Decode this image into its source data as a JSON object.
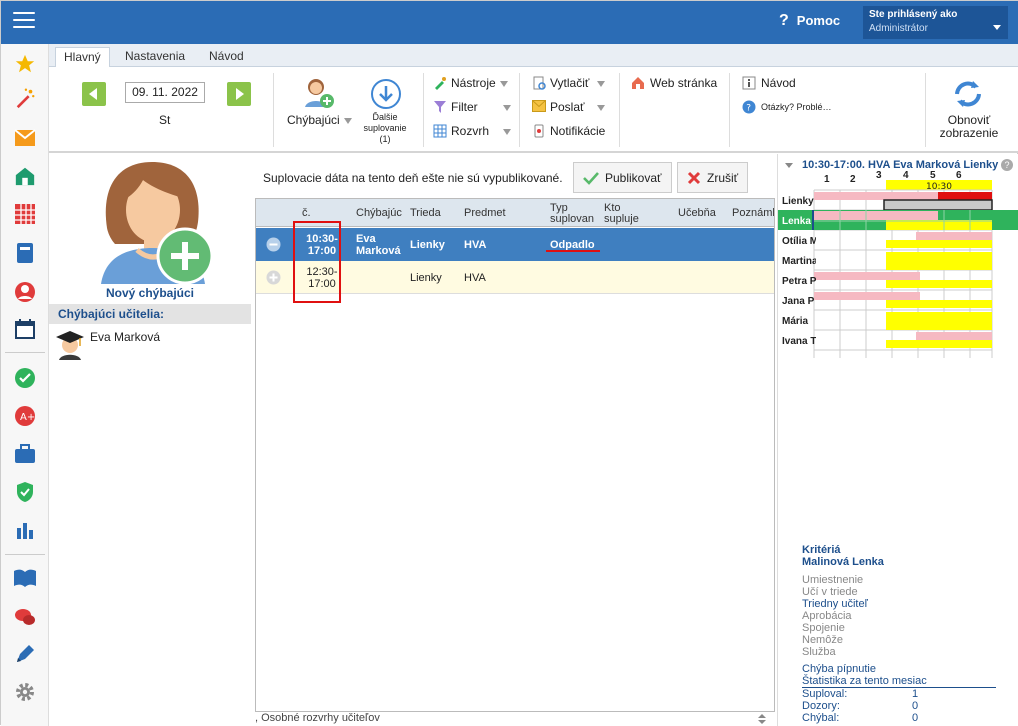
{
  "header": {
    "help": "Pomoc",
    "user_line1": "Ste prihlásený ako",
    "user_line2": "Administrátor"
  },
  "tabs": [
    {
      "label": "Hlavný"
    },
    {
      "label": "Nastavenia"
    },
    {
      "label": "Návod"
    }
  ],
  "ribbon": {
    "date": "09. 11. 2022",
    "day": "St",
    "chybajuci": "Chýbajúci",
    "dalsie_1": "Ďalšie",
    "dalsie_2": "suplovanie",
    "dalsie_3": "(1)",
    "nastroje": "Nástroje",
    "filter": "Filter",
    "rozvrh": "Rozvrh",
    "vytlacit": "Vytlačiť",
    "poslat": "Poslať",
    "notifikacie": "Notifikácie",
    "web": "Web stránka",
    "navod": "Návod",
    "otazky": "Otázky? Problé…",
    "obnovit_1": "Obnoviť",
    "obnovit_2": "zobrazenie"
  },
  "left": {
    "new_absent": "Nový chýbajúci",
    "section": "Chýbajúci učitelia:",
    "teacher": "Eva Marková"
  },
  "center": {
    "message": "Suplovacie dáta na tento deň ešte nie sú vypublikované.",
    "publish": "Publikovať",
    "cancel": "Zrušiť",
    "columns": {
      "c": "č.",
      "chybajuci": "Chýbajúc",
      "trieda": "Trieda",
      "predmet": "Predmet",
      "typ_1": "Typ",
      "typ_2": "suplovan",
      "kto_1": "Kto",
      "kto_2": "supluje",
      "ucebna": "Učebňa",
      "poznamka": "Poznámk"
    },
    "rows": [
      {
        "time_1": "10:30-",
        "time_2": "17:00",
        "absent_1": "Eva",
        "absent_2": "Marková",
        "trieda": "Lienky",
        "predmet": "HVA",
        "typ": "Odpadlo"
      },
      {
        "time_1": "12:30-",
        "time_2": "17:00",
        "absent_1": "",
        "absent_2": "",
        "trieda": "Lienky",
        "predmet": "HVA",
        "typ": ""
      }
    ],
    "status": ", Osobné rozvrhy učiteľov"
  },
  "right": {
    "title": "10:30-17:00. HVA Eva Marková Lienky",
    "slots": [
      "1",
      "2",
      "3",
      "4",
      "5",
      "6"
    ],
    "slot_time": "10:30",
    "teachers": [
      "Lienky",
      "Lenka",
      "Otília M",
      "Martina",
      "Petra P",
      "Jana P",
      "Mária",
      "Ivana T"
    ],
    "criteria_title": "Kritériá",
    "criteria_name": "Malinová Lenka",
    "criteria": [
      {
        "label": "Umiestnenie",
        "active": false
      },
      {
        "label": "Učí v triede",
        "active": false
      },
      {
        "label": "Triedny učiteľ",
        "active": true
      },
      {
        "label": "Aprobácia",
        "active": false
      },
      {
        "label": "Spojenie",
        "active": false
      },
      {
        "label": "Nemôže",
        "active": false
      },
      {
        "label": "Služba",
        "active": false
      }
    ],
    "chyba": "Chýba pípnutie",
    "stats_title": "Štatistika za tento mesiac",
    "stats": [
      {
        "label": "Suploval:",
        "value": "1"
      },
      {
        "label": "Dozory:",
        "value": "0"
      },
      {
        "label": "Chýbal:",
        "value": "0"
      }
    ]
  },
  "colors": {
    "accent": "#2b6cb5",
    "selected_row": "#3f7fc0",
    "highlight": "#e01010",
    "yellow": "#ffff00",
    "pink": "#f6b9c2",
    "green": "#2fb35c"
  }
}
